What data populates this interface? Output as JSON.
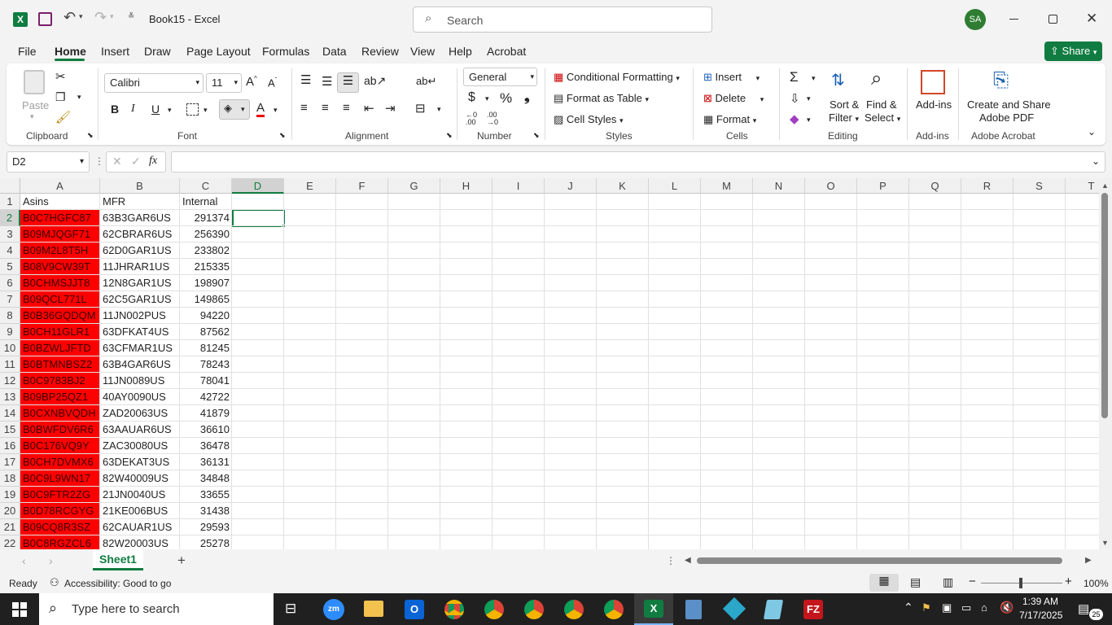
{
  "titlebar": {
    "doc_title": "Book15  -  Excel",
    "search_placeholder": "Search",
    "avatar": "SA"
  },
  "menu": [
    "File",
    "Home",
    "Insert",
    "Draw",
    "Page Layout",
    "Formulas",
    "Data",
    "Review",
    "View",
    "Help",
    "Acrobat"
  ],
  "share_label": "Share",
  "ribbon": {
    "clipboard": {
      "paste": "Paste",
      "label": "Clipboard"
    },
    "font": {
      "name": "Calibri",
      "size": "11",
      "label": "Font"
    },
    "alignment": {
      "label": "Alignment"
    },
    "number": {
      "format": "General",
      "label": "Number"
    },
    "styles": {
      "conditional": "Conditional Formatting",
      "format_table": "Format as Table",
      "cell_styles": "Cell Styles",
      "label": "Styles"
    },
    "cells": {
      "insert": "Insert",
      "delete": "Delete",
      "format": "Format",
      "label": "Cells"
    },
    "editing": {
      "sort": "Sort &",
      "filter": "Filter",
      "find": "Find &",
      "select": "Select",
      "label": "Editing"
    },
    "addins": {
      "btn": "Add-ins",
      "label": "Add-ins"
    },
    "acrobat": {
      "line1": "Create and Share",
      "line2": "Adobe PDF",
      "label": "Adobe Acrobat"
    }
  },
  "namebox": "D2",
  "fx": "fx",
  "columns": [
    "A",
    "B",
    "C",
    "D",
    "E",
    "F",
    "G",
    "H",
    "I",
    "J",
    "K",
    "L",
    "M",
    "N",
    "O",
    "P",
    "Q",
    "R",
    "S",
    "T"
  ],
  "header_row": [
    "Asins",
    "MFR",
    "Internal"
  ],
  "rows": [
    [
      "B0C7HGFC87",
      "63B3GAR6US",
      "291374"
    ],
    [
      "B09MJQGF71",
      "62CBRAR6US",
      "256390"
    ],
    [
      "B09M2L8T5H",
      "62D0GAR1US",
      "233802"
    ],
    [
      "B08V9CW39T",
      "11JHRAR1US",
      "215335"
    ],
    [
      "B0CHMSJJT8",
      "12N8GAR1US",
      "198907"
    ],
    [
      "B09QCL771L",
      "62C5GAR1US",
      "149865"
    ],
    [
      "B0B36GQDQM",
      "11JN002PUS",
      "94220"
    ],
    [
      "B0CH11GLR1",
      "63DFKAT4US",
      "87562"
    ],
    [
      "B0BZWLJFTD",
      "63CFMAR1US",
      "81245"
    ],
    [
      "B0BTMNBSZ2",
      "63B4GAR6US",
      "78243"
    ],
    [
      "B0C9783BJ2",
      "11JN0089US",
      "78041"
    ],
    [
      "B09BP25QZ1",
      "40AY0090US",
      "42722"
    ],
    [
      "B0CXNBVQDH",
      "ZAD20063US",
      "41879"
    ],
    [
      "B0BWFDV6R6",
      "63AAUAR6US",
      "36610"
    ],
    [
      "B0C176VQ9Y",
      "ZAC30080US",
      "36478"
    ],
    [
      "B0CH7DVMX6",
      "63DEKAT3US",
      "36131"
    ],
    [
      "B0C9L9WN17",
      "82W40009US",
      "34848"
    ],
    [
      "B0C9FTR2ZG",
      "21JN0040US",
      "33655"
    ],
    [
      "B0D78RCGYG",
      "21KE006BUS",
      "31438"
    ],
    [
      "B09CQ8R3SZ",
      "62CAUAR1US",
      "29593"
    ],
    [
      "B0C8RGZCL6",
      "82W20003US",
      "25278"
    ]
  ],
  "sheet_tab": "Sheet1",
  "status": {
    "ready": "Ready",
    "accessibility": "Accessibility: Good to go",
    "zoom": "100%"
  },
  "taskbar": {
    "search_placeholder": "Type here to search",
    "time": "1:39 AM",
    "date": "7/17/2025",
    "notif": "25"
  },
  "colors": {
    "red_fill": "#ff0000",
    "excel_green": "#107c41"
  }
}
